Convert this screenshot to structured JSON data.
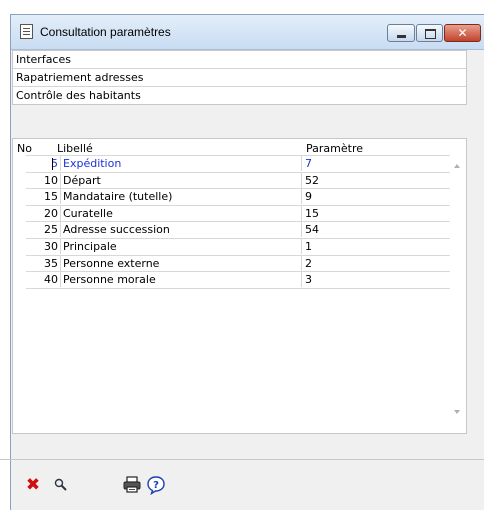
{
  "window": {
    "title": "Consultation paramètres"
  },
  "menu": {
    "items": [
      "Interfaces",
      "Rapatriement adresses",
      "Contrôle des habitants"
    ]
  },
  "grid": {
    "columns": {
      "no": "No",
      "label": "Libellé",
      "param": "Paramètre"
    },
    "rows": [
      {
        "no": "5",
        "label": "Expédition",
        "param": "7"
      },
      {
        "no": "10",
        "label": "Départ",
        "param": "52"
      },
      {
        "no": "15",
        "label": "Mandataire (tutelle)",
        "param": "9"
      },
      {
        "no": "20",
        "label": "Curatelle",
        "param": "15"
      },
      {
        "no": "25",
        "label": "Adresse succession",
        "param": "54"
      },
      {
        "no": "30",
        "label": "Principale",
        "param": "1"
      },
      {
        "no": "35",
        "label": "Personne externe",
        "param": "2"
      },
      {
        "no": "40",
        "label": "Personne morale",
        "param": "3"
      }
    ]
  },
  "colors": {
    "selected_text": "#1a33d9",
    "close_button": "#c1432c",
    "delete_icon": "#d01010"
  },
  "toolbar": {
    "icons": [
      "delete-icon",
      "search-icon",
      "print-icon",
      "help-icon"
    ]
  }
}
